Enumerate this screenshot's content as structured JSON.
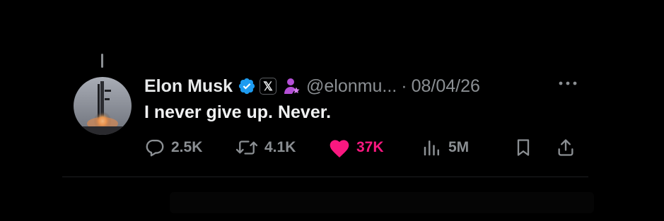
{
  "tweet": {
    "author_name": "Elon Musk",
    "affiliation_badge": "𝕏",
    "handle": "@elonmu...",
    "separator": "·",
    "date": "08/04/26",
    "text": "I never give up. Never."
  },
  "actions": {
    "replies": "2.5K",
    "reposts": "4.1K",
    "likes": "37K",
    "views": "5M"
  },
  "colors": {
    "background": "#000000",
    "primary_text": "#e7e9ea",
    "secondary_text": "#8b8f93",
    "verified_blue": "#1d9bf0",
    "like_pink": "#f91880",
    "person_icon_purple": "#b44fd6"
  },
  "icons": {
    "verified": "verified-badge-icon",
    "affiliation": "x-logo-icon",
    "person": "person-star-icon",
    "more": "more-options-icon",
    "reply": "reply-icon",
    "repost": "repost-icon",
    "like": "heart-icon",
    "views": "views-icon",
    "bookmark": "bookmark-icon",
    "share": "share-icon"
  }
}
